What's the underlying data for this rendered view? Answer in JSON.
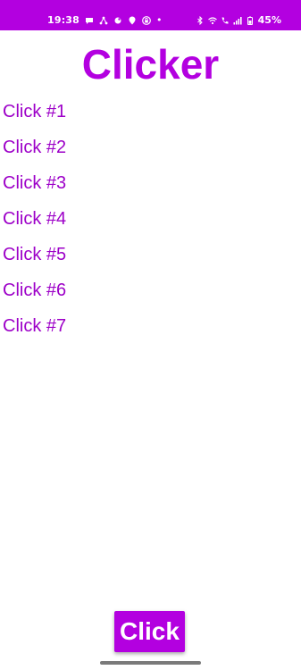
{
  "status_bar": {
    "time": "19:38",
    "dot": "•",
    "battery": "45%",
    "background_color": "#b300e0",
    "left_icons": [
      "chat-bubble-icon",
      "share-nodes-icon",
      "dot-icon",
      "location-pin-icon",
      "vpn-lock-icon"
    ],
    "right_icons": [
      "bluetooth-icon",
      "wifi-icon",
      "wifi-calling-icon",
      "signal-icon",
      "battery-icon"
    ]
  },
  "app": {
    "title": "Clicker",
    "accent_color": "#b300e0",
    "text_color": "#9d00c8"
  },
  "clicks": [
    "Click #1",
    "Click #2",
    "Click #3",
    "Click #4",
    "Click #5",
    "Click #6",
    "Click #7"
  ],
  "button": {
    "label": "Click"
  }
}
